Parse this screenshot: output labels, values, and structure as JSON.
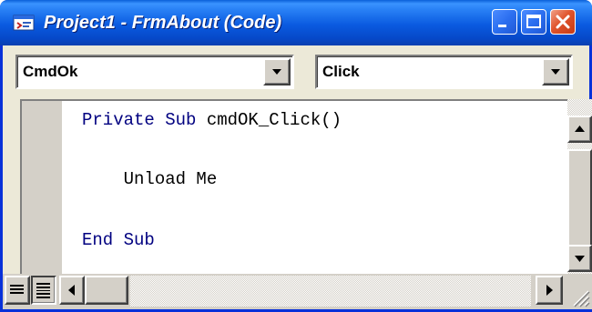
{
  "window": {
    "title": "Project1 - FrmAbout (Code)",
    "colors": {
      "titlebar": "#0a5ae0",
      "keyword": "#000080",
      "text": "#000000",
      "chrome": "#ece9d8"
    }
  },
  "icons": {
    "window": "code-window-icon",
    "minimize": "minimize-icon",
    "maximize": "maximize-icon",
    "close": "close-icon",
    "dropdown": "chevron-down-icon",
    "procedure_view": "procedure-view-icon",
    "full_module_view": "full-module-view-icon"
  },
  "object_combo": {
    "value": "CmdOk"
  },
  "procedure_combo": {
    "value": "Click"
  },
  "code": {
    "lines": [
      {
        "keyword": "Private Sub",
        "text": " cmdOK_Click()"
      },
      {
        "keyword": "",
        "text": "    Unload Me"
      },
      {
        "keyword": "End Sub",
        "text": ""
      }
    ]
  }
}
